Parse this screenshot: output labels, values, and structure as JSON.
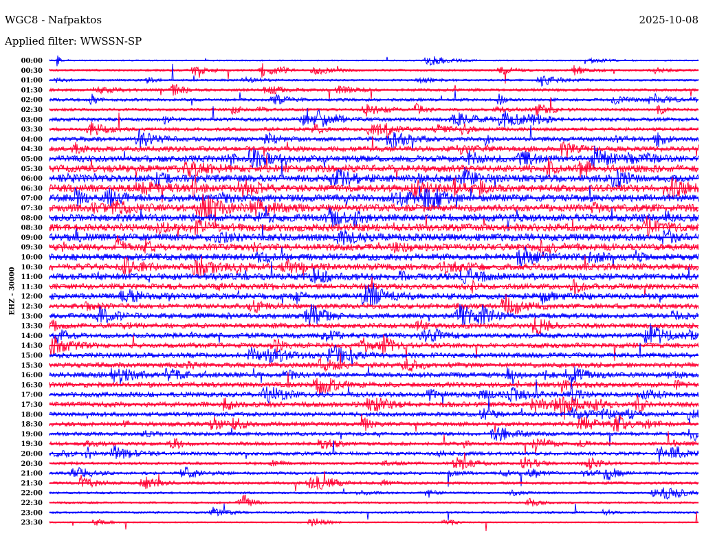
{
  "header": {
    "title": "WGC8 - Nafpaktos",
    "filter": "Applied filter: WWSSN-SP",
    "date": "2025-10-08"
  },
  "chart_data": {
    "type": "line",
    "title": "WGC8 - Nafpaktos",
    "subtitle": "Applied filter: WWSSN-SP",
    "ylabel": "EHZ - 30000",
    "xlabel": "",
    "colors": [
      "#0000ff",
      "#ff0033"
    ],
    "row_labels": [
      "00:00",
      "00:30",
      "01:00",
      "01:30",
      "02:00",
      "02:30",
      "03:00",
      "03:30",
      "04:00",
      "04:30",
      "05:00",
      "05:30",
      "06:00",
      "06:30",
      "07:00",
      "07:30",
      "08:00",
      "08:30",
      "09:00",
      "09:30",
      "10:00",
      "10:30",
      "11:00",
      "11:30",
      "12:00",
      "12:30",
      "13:00",
      "13:30",
      "14:00",
      "14:30",
      "15:00",
      "15:30",
      "16:00",
      "16:30",
      "17:00",
      "17:30",
      "18:00",
      "18:30",
      "19:00",
      "19:30",
      "20:00",
      "20:30",
      "21:00",
      "21:30",
      "22:00",
      "22:30",
      "23:00",
      "23:30"
    ],
    "row_activity": [
      1,
      2,
      2,
      3,
      3,
      3,
      4,
      4,
      5,
      6,
      8,
      9,
      9,
      9,
      9,
      9,
      9,
      9,
      9,
      8,
      8,
      8,
      8,
      7,
      7,
      6,
      6,
      6,
      6,
      6,
      6,
      6,
      6,
      6,
      6,
      6,
      5,
      5,
      4,
      4,
      4,
      3,
      3,
      3,
      2,
      2,
      2,
      1
    ]
  }
}
